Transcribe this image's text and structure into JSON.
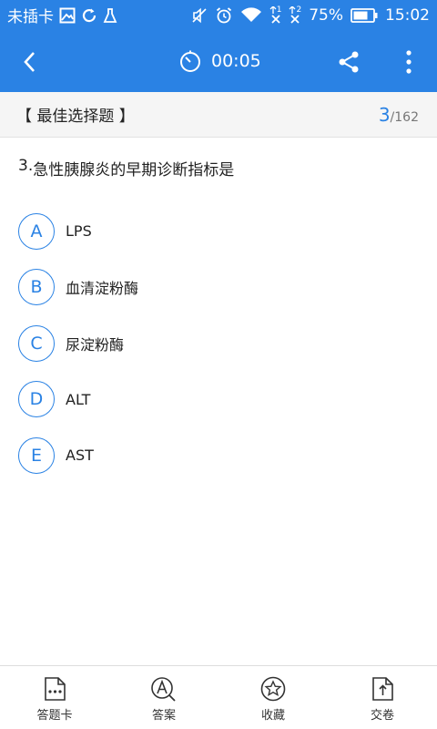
{
  "status_bar": {
    "carrier": "未插卡",
    "battery": "75%",
    "time": "15:02",
    "sim1": "1",
    "sim2": "2",
    "icons": [
      "image-icon",
      "sync-icon",
      "cleaner-icon",
      "mute-icon",
      "alarm-icon",
      "wifi-icon",
      "sim1-signal-icon",
      "sim2-signal-icon",
      "battery-icon"
    ]
  },
  "app_bar": {
    "timer": "00:05",
    "icons": [
      "back-icon",
      "timer-icon",
      "share-icon",
      "more-icon"
    ]
  },
  "question_meta": {
    "type": "【 最佳选择题 】",
    "current": "3",
    "separator": "/",
    "total": "162"
  },
  "question": {
    "number": "3. ",
    "text": "急性胰腺炎的早期诊断指标是"
  },
  "options": [
    {
      "letter": "A",
      "text": "LPS"
    },
    {
      "letter": "B",
      "text": "血清淀粉酶"
    },
    {
      "letter": "C",
      "text": "尿淀粉酶"
    },
    {
      "letter": "D",
      "text": "ALT"
    },
    {
      "letter": "E",
      "text": "AST"
    }
  ],
  "bottom_tabs": [
    {
      "label": "答题卡",
      "icon": "answer-sheet-icon"
    },
    {
      "label": "答案",
      "icon": "answer-icon"
    },
    {
      "label": "收藏",
      "icon": "favorite-star-icon"
    },
    {
      "label": "交卷",
      "icon": "submit-icon"
    }
  ],
  "colors": {
    "primary": "#2a82e4",
    "header_bg": "#f5f5f5",
    "text": "#222222"
  }
}
